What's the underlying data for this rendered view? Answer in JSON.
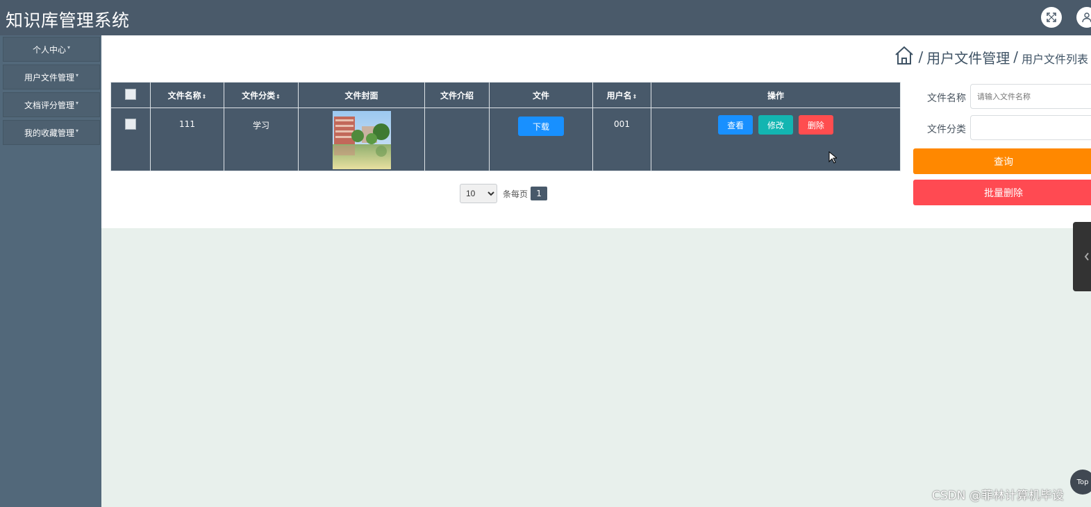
{
  "header": {
    "app_title": "知识库管理系统",
    "icons": [
      "fullscreen-icon",
      "user-icon"
    ]
  },
  "sidebar": {
    "items": [
      {
        "label": "个人中心"
      },
      {
        "label": "用户文件管理"
      },
      {
        "label": "文档评分管理"
      },
      {
        "label": "我的收藏管理"
      }
    ]
  },
  "breadcrumb": {
    "icon": "home-icon",
    "separator": "/",
    "level1": "用户文件管理",
    "level2": "用户文件列表"
  },
  "table": {
    "columns": [
      "文件名称",
      "文件分类",
      "文件封面",
      "文件介绍",
      "文件",
      "用户名",
      "操作"
    ],
    "sort_glyph": "⇕",
    "rows": [
      {
        "file_name": "111",
        "category": "学习",
        "intro": "",
        "download_label": "下载",
        "username": "001",
        "view_label": "查看",
        "edit_label": "修改",
        "delete_label": "删除"
      }
    ]
  },
  "pagination": {
    "page_size": "10",
    "page_size_options": [
      "10"
    ],
    "per_page_label": "条每页",
    "current_page": "1"
  },
  "search": {
    "name_label": "文件名称",
    "name_placeholder": "请输入文件名称",
    "name_value": "",
    "category_label": "文件分类",
    "category_value": "",
    "query_label": "查询",
    "batch_delete_label": "批量删除"
  },
  "top_button": "Top",
  "watermark": "CSDN @菲林计算机毕设",
  "colors": {
    "header_bg": "#4a5a6a",
    "sidebar_bg": "#52687a",
    "table_bg": "#48596a",
    "primary": "#1890ff",
    "teal": "#13b5b1",
    "danger": "#ff4d4f",
    "orange": "#ff8800",
    "page_bg": "#e8f0ec"
  }
}
